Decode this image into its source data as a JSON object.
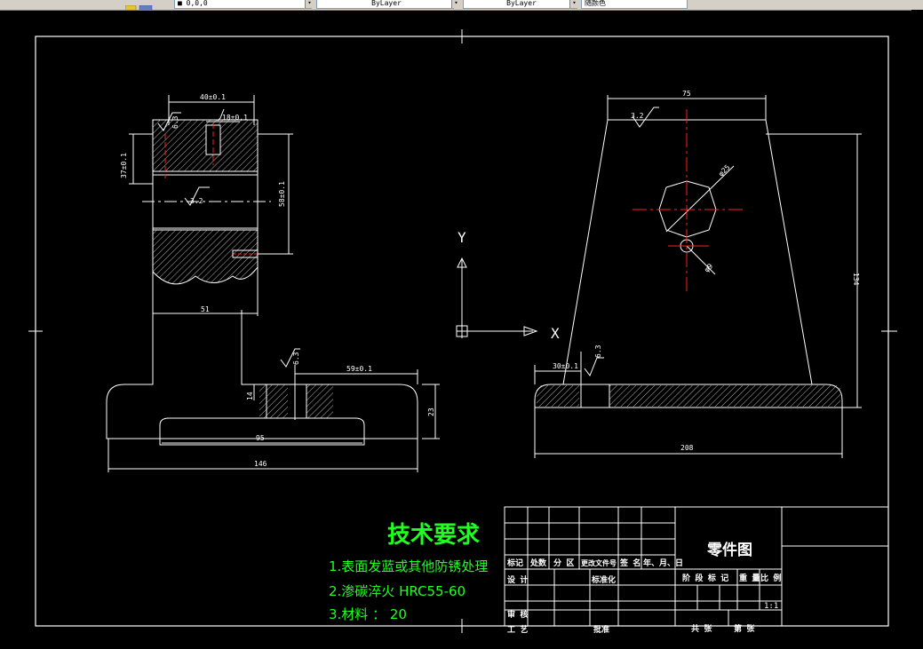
{
  "toolbar": {
    "color_field": "■ 0,0,0",
    "linetype_field": "ByLayer",
    "lineweight_field": "ByLayer",
    "plotstyle_field": "随颜色"
  },
  "icons": {
    "toolbar_icon": "layer-icon",
    "ucs_icon": "ucs-icon",
    "arrow": "dropdown-arrow-icon"
  },
  "colors": {
    "background": "#000000",
    "lines": "#ffffff",
    "center_lines": "#ff2020",
    "text_notes": "#20ff20"
  },
  "drawing": {
    "front_view": {
      "dim_top_width": "40±0.1",
      "dim_groove": "18±0.1",
      "dim_left_height": "37±0.1",
      "dim_right_height": "58±0.1",
      "roughness_top": "6.3",
      "roughness_mid": "3.2",
      "dim_neck": "51",
      "roughness_base": "6.3",
      "dim_base_slot": "59±0.1",
      "dim_base_thick": "14",
      "dim_base_height": "23",
      "dim_base_inner": "95",
      "dim_base_total": "146"
    },
    "side_view": {
      "dim_top": "75",
      "roughness_top": "3.2",
      "dim_hole": "φ25",
      "dim_small_hole": "φ9",
      "dim_height": "134",
      "dim_base_left": "30±0.1",
      "roughness_base": "6.3",
      "dim_base_total": "208"
    },
    "axis": {
      "y": "Y",
      "x": "X"
    }
  },
  "notes": {
    "title": "技术要求",
    "items": [
      "1.表面发蓝或其他防锈处理",
      "2.渗碳淬火 HRC55-60",
      "3.材料 ： 20"
    ]
  },
  "title_block": {
    "drawing_name": "零件图",
    "row_labels": [
      "标记",
      "处数",
      "分 区",
      "更改文件号",
      "签 名",
      "年、月、日"
    ],
    "design": "设 计",
    "standardize": "标准化",
    "review": "审 核",
    "process": "工 艺",
    "approve": "批准",
    "stage_mark": "阶 段 标 记",
    "weight": "重 量",
    "scale": "比 例",
    "scale_value": "1:1",
    "sheets_total": "共    张",
    "sheet_no": "第    张"
  }
}
